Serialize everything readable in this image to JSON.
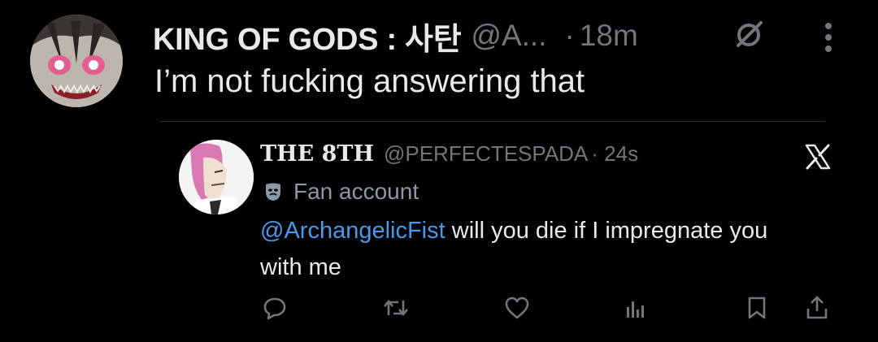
{
  "main_tweet": {
    "display_name": "KING OF GODS : 사탄",
    "handle": "@A...",
    "separator": "·",
    "time": "18m",
    "text": "I’m not fucking answering that"
  },
  "quoted_tweet": {
    "display_name": "THE 8TH",
    "handle": "@PERFECTESPADA",
    "time": "· 24s",
    "badge_label": "Fan account",
    "mention": "@ArchangelicFist",
    "text": " will you die if I impregnate you with me"
  },
  "icons": {
    "header": [
      "no-entry-icon",
      "more-icon"
    ],
    "quote": [
      "x-logo-icon",
      "mask-icon"
    ],
    "actions": [
      "reply-icon",
      "retweet-icon",
      "like-icon",
      "views-icon",
      "bookmark-icon",
      "share-icon"
    ]
  },
  "colors": {
    "background": "#000000",
    "text": "#e7e9ea",
    "muted": "#71767b",
    "mention": "#4a99e9",
    "divider": "#2f3336"
  }
}
